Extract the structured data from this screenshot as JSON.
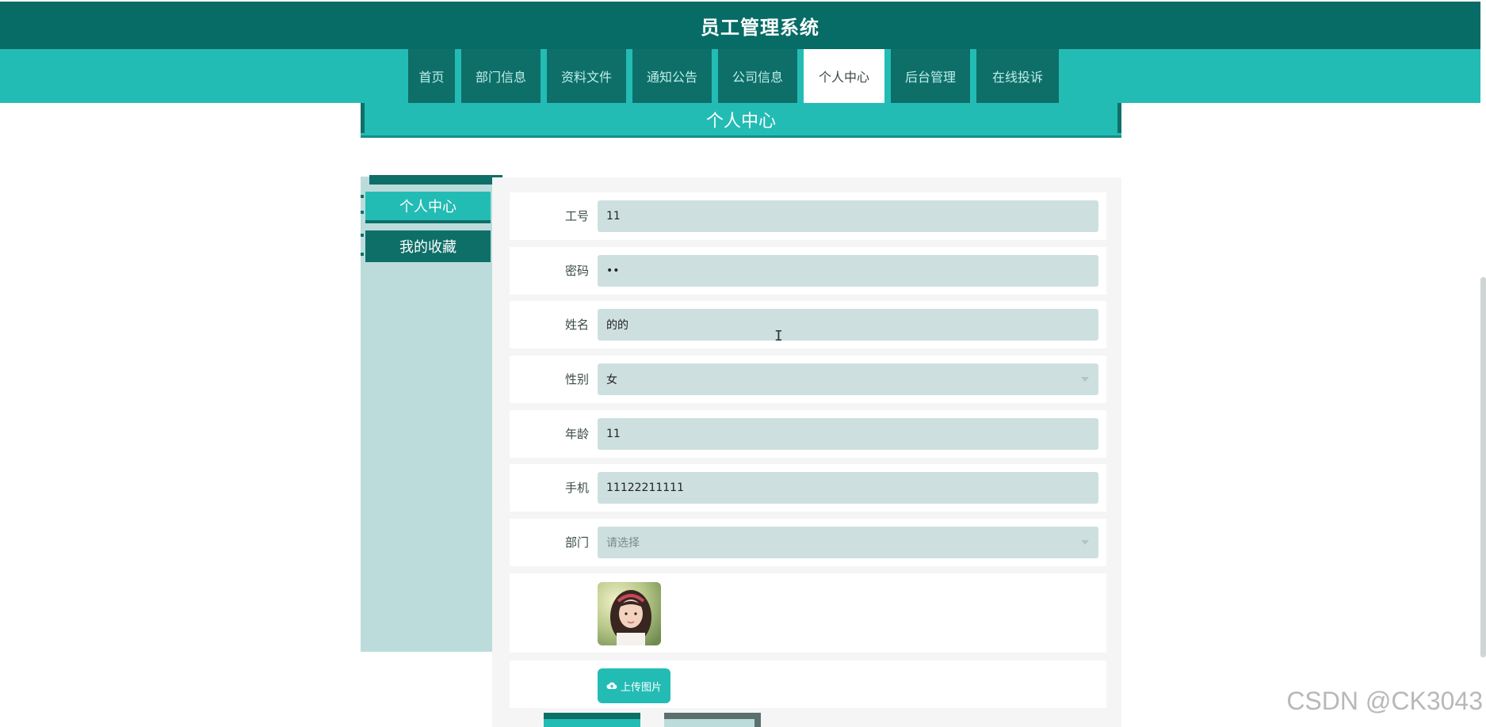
{
  "header": {
    "title": "员工管理系统"
  },
  "nav": {
    "items": [
      {
        "label": "首页",
        "active": false
      },
      {
        "label": "部门信息",
        "active": false
      },
      {
        "label": "资料文件",
        "active": false
      },
      {
        "label": "通知公告",
        "active": false
      },
      {
        "label": "公司信息",
        "active": false
      },
      {
        "label": "个人中心",
        "active": true
      },
      {
        "label": "后台管理",
        "active": false
      },
      {
        "label": "在线投诉",
        "active": false
      }
    ]
  },
  "page": {
    "heading": "个人中心"
  },
  "sidebar": {
    "items": [
      {
        "label": "个人中心",
        "active": true
      },
      {
        "label": "我的收藏",
        "active": false
      }
    ]
  },
  "form": {
    "fields": [
      {
        "label": "工号",
        "value": "11",
        "type": "text"
      },
      {
        "label": "密码",
        "value": "••",
        "type": "password"
      },
      {
        "label": "姓名",
        "value": "的的",
        "type": "text"
      },
      {
        "label": "性别",
        "value": "女",
        "type": "select"
      },
      {
        "label": "年龄",
        "value": "11",
        "type": "text"
      },
      {
        "label": "手机",
        "value": "11122211111",
        "type": "text"
      },
      {
        "label": "部门",
        "value": "请选择",
        "type": "select",
        "placeholder": true
      }
    ],
    "upload_label": "上传图片"
  },
  "watermark": "CSDN @CK3043",
  "colors": {
    "dark_teal": "#076c66",
    "teal": "#23bcb4",
    "nav_item": "#0e6f69",
    "input_bg": "#cde0df"
  }
}
